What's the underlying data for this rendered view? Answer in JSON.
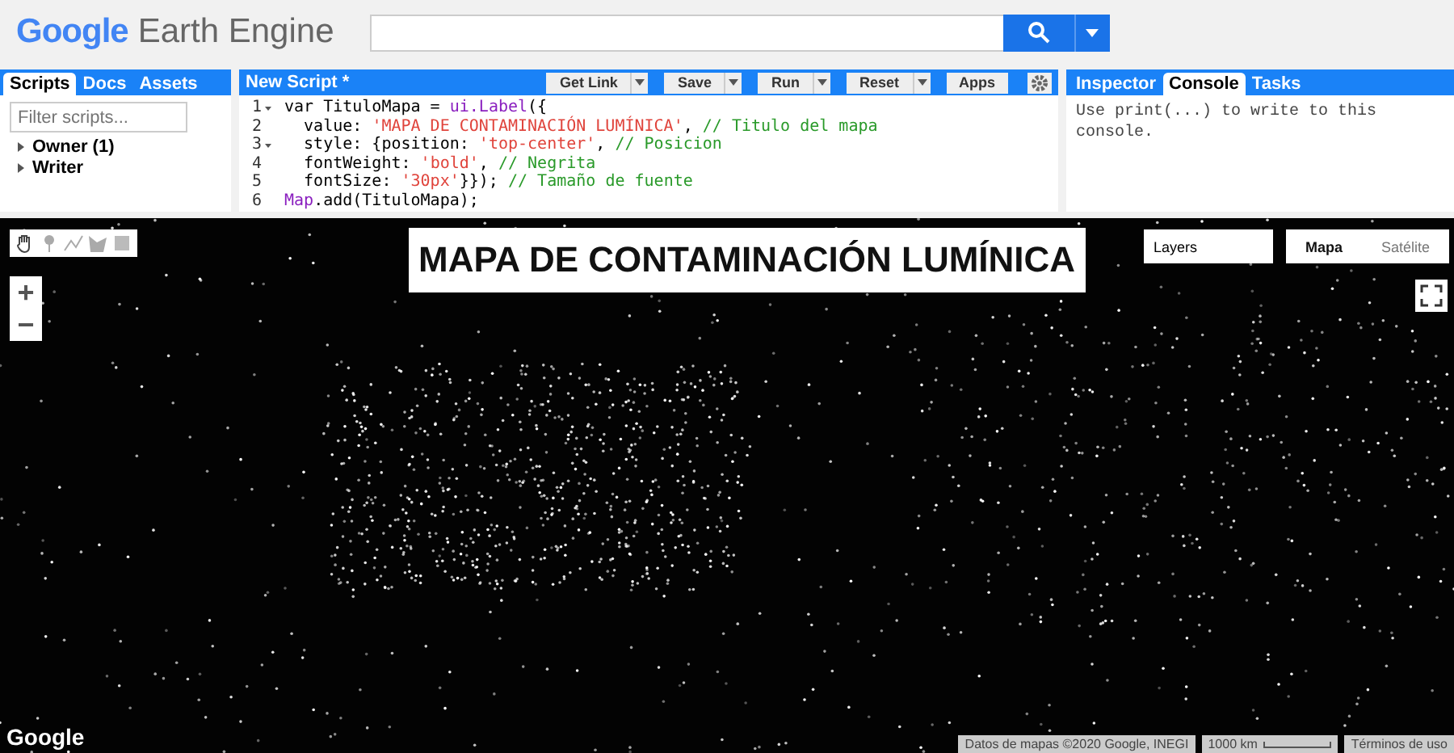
{
  "header": {
    "logo_google": "Google",
    "logo_product": "Earth Engine"
  },
  "scripts_panel": {
    "tabs": [
      {
        "label": "Scripts",
        "selected": true
      },
      {
        "label": "Docs",
        "selected": false
      },
      {
        "label": "Assets",
        "selected": false
      }
    ],
    "filter": {
      "placeholder": "Filter scripts..."
    },
    "tree": [
      {
        "label": "Owner (1)",
        "expanded": false
      },
      {
        "label": "Writer",
        "expanded": false
      }
    ]
  },
  "editor": {
    "title": "New Script *",
    "buttons": [
      {
        "label": "Get Link",
        "dropdown": true
      },
      {
        "label": "Save",
        "dropdown": true
      },
      {
        "label": "Run",
        "dropdown": true
      },
      {
        "label": "Reset",
        "dropdown": true
      },
      {
        "label": "Apps",
        "dropdown": false
      }
    ],
    "lines": [
      {
        "number": "1",
        "foldable": true,
        "tokens": [
          {
            "kind": "keyword",
            "text": "var"
          },
          {
            "kind": "plain",
            "text": " TituloMapa = "
          },
          {
            "kind": "builtin",
            "text": "ui.Label"
          },
          {
            "kind": "plain",
            "text": "({"
          }
        ]
      },
      {
        "number": "2",
        "foldable": false,
        "tokens": [
          {
            "kind": "plain",
            "text": "  value: "
          },
          {
            "kind": "string",
            "text": "'MAPA DE CONTAMINACIÓN LUMÍNICA'"
          },
          {
            "kind": "plain",
            "text": ", "
          },
          {
            "kind": "comment",
            "text": "// Titulo del mapa"
          }
        ]
      },
      {
        "number": "3",
        "foldable": true,
        "tokens": [
          {
            "kind": "plain",
            "text": "  style: {position: "
          },
          {
            "kind": "string",
            "text": "'top-center'"
          },
          {
            "kind": "plain",
            "text": ", "
          },
          {
            "kind": "comment",
            "text": "// Posicion"
          }
        ]
      },
      {
        "number": "4",
        "foldable": false,
        "tokens": [
          {
            "kind": "plain",
            "text": "  fontWeight: "
          },
          {
            "kind": "string",
            "text": "'bold'"
          },
          {
            "kind": "plain",
            "text": ", "
          },
          {
            "kind": "comment",
            "text": "// Negrita"
          }
        ]
      },
      {
        "number": "5",
        "foldable": false,
        "tokens": [
          {
            "kind": "plain",
            "text": "  fontSize: "
          },
          {
            "kind": "string",
            "text": "'30px'"
          },
          {
            "kind": "plain",
            "text": "}}); "
          },
          {
            "kind": "comment",
            "text": "// Tamaño de fuente"
          }
        ]
      },
      {
        "number": "6",
        "foldable": false,
        "tokens": [
          {
            "kind": "builtin",
            "text": "Map"
          },
          {
            "kind": "plain",
            "text": ".add(TituloMapa);"
          }
        ]
      }
    ]
  },
  "right_panel": {
    "tabs": [
      {
        "label": "Inspector",
        "selected": false
      },
      {
        "label": "Console",
        "selected": true
      },
      {
        "label": "Tasks",
        "selected": false
      }
    ],
    "console_text": "Use print(...) to write to this console."
  },
  "map": {
    "title": "MAPA DE CONTAMINACIÓN LUMÍNICA",
    "layers": "Layers",
    "map_types": [
      {
        "label": "Mapa",
        "selected": true
      },
      {
        "label": "Satélite",
        "selected": false
      }
    ],
    "zoom": {
      "in": "+",
      "out": "−"
    },
    "google": "Google",
    "attribution": "Datos de mapas ©2020 Google, INEGI",
    "scale": "1000 km",
    "terms": "Términos de uso"
  }
}
